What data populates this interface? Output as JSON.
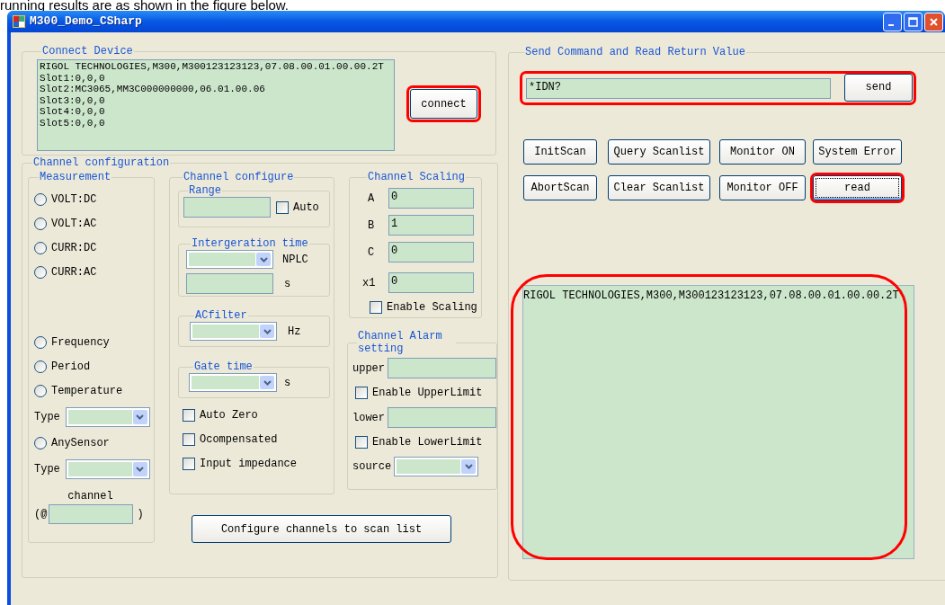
{
  "caption": "running results are as shown in the figure below.",
  "window": {
    "title": "M300_Demo_CSharp"
  },
  "connect_device": {
    "title": "Connect Device",
    "lines": [
      "RIGOL TECHNOLOGIES,M300,M300123123123,07.08.00.01.00.00.2T",
      "Slot1:0,0,0",
      "Slot2:MC3065,MM3C000000000,06.01.00.06",
      "Slot3:0,0,0",
      "Slot4:0,0,0",
      "Slot5:0,0,0"
    ],
    "button": {
      "label": "connect",
      "highlighted": true
    }
  },
  "channel_configuration": {
    "title": "Channel configuration",
    "measurement": {
      "title": "Measurement",
      "primary": [
        {
          "label": "VOLT:DC",
          "selected": false
        },
        {
          "label": "VOLT:AC",
          "selected": false
        },
        {
          "label": "CURR:DC",
          "selected": false
        },
        {
          "label": "CURR:AC",
          "selected": false
        }
      ],
      "secondary": [
        {
          "kind": "radio",
          "label": "Frequency",
          "selected": false
        },
        {
          "kind": "radio",
          "label": "Period",
          "selected": false
        },
        {
          "kind": "radio",
          "label": "Temperature",
          "selected": false
        },
        {
          "kind": "dropdown",
          "label": "Type"
        },
        {
          "kind": "radio",
          "label": "AnySensor",
          "selected": false
        },
        {
          "kind": "dropdown",
          "label": "Type"
        },
        {
          "kind": "channel",
          "label": "channel",
          "prefix": "(@",
          "suffix": ")"
        }
      ]
    },
    "channel_configure": {
      "title": "Channel configure",
      "range": {
        "title": "Range",
        "auto": {
          "label": "Auto",
          "checked": false
        }
      },
      "integration": {
        "title": "Intergeration time",
        "unit": "NPLC",
        "seconds_unit": "s"
      },
      "acfilter": {
        "title": "ACfilter",
        "unit": "Hz"
      },
      "gate_time": {
        "title": "Gate time",
        "unit": "s"
      },
      "checkboxes": [
        {
          "label": "Auto Zero",
          "checked": false
        },
        {
          "label": "Ocompensated",
          "checked": false
        },
        {
          "label": "Input impedance",
          "checked": false
        }
      ]
    },
    "scaling": {
      "title": "Channel Scaling",
      "fields": [
        {
          "label": "A",
          "value": "0"
        },
        {
          "label": "B",
          "value": "1"
        },
        {
          "label": "C",
          "value": "0"
        },
        {
          "label": "x1",
          "value": "0"
        }
      ],
      "enable": {
        "label": "Enable Scaling",
        "checked": false
      }
    },
    "alarm": {
      "title": "Channel Alarm setting",
      "items": [
        {
          "kind": "field",
          "label": "upper"
        },
        {
          "kind": "checkbox",
          "label": "Enable UpperLimit",
          "checked": false
        },
        {
          "kind": "field",
          "label": "lower"
        },
        {
          "kind": "checkbox",
          "label": "Enable LowerLimit",
          "checked": false
        },
        {
          "kind": "dropdown",
          "label": "source"
        }
      ]
    },
    "configure_button": {
      "label": "Configure channels to scan list"
    }
  },
  "send_command": {
    "title": "Send Command and Read Return Value",
    "highlighted": true,
    "command": {
      "value": "*IDN?"
    },
    "send_button": {
      "label": "send"
    },
    "buttons": [
      {
        "label": "InitScan",
        "highlighted": false,
        "focused": false
      },
      {
        "label": "Query Scanlist",
        "highlighted": false,
        "focused": false
      },
      {
        "label": "Monitor ON",
        "highlighted": false,
        "focused": false
      },
      {
        "label": "System Error",
        "highlighted": false,
        "focused": false
      },
      {
        "label": "AbortScan",
        "highlighted": false,
        "focused": false
      },
      {
        "label": "Clear Scanlist",
        "highlighted": false,
        "focused": false
      },
      {
        "label": "Monitor OFF",
        "highlighted": false,
        "focused": false
      },
      {
        "label": "read",
        "highlighted": true,
        "focused": true
      }
    ],
    "response": {
      "value": "RIGOL TECHNOLOGIES,M300,M300123123123,07.08.00.01.00.00.2T",
      "highlighted": true
    }
  }
}
